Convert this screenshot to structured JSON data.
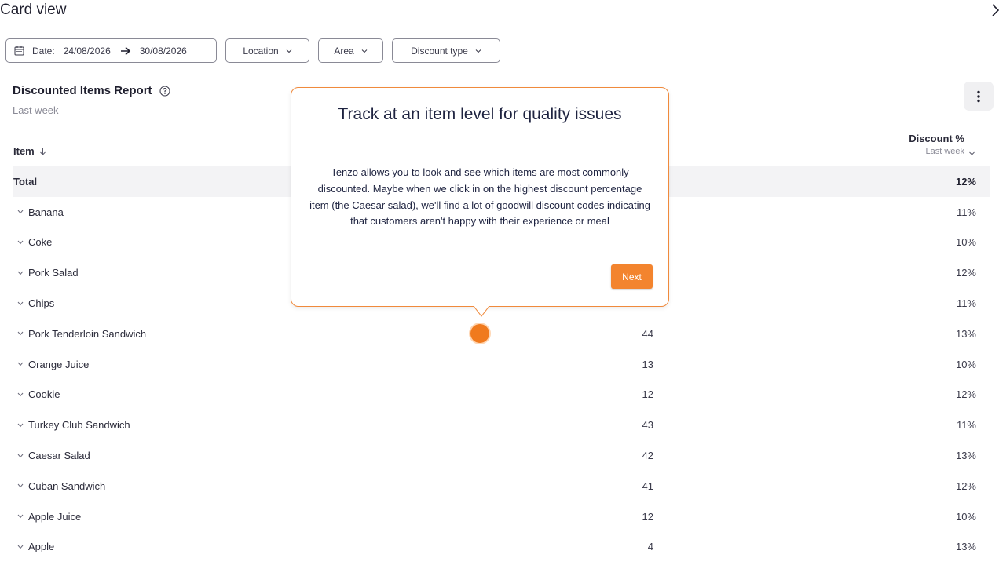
{
  "page": {
    "title": "Card view"
  },
  "filters": {
    "date_label": "Date:",
    "date_from": "24/08/2026",
    "date_to": "30/08/2026",
    "location": "Location",
    "area": "Area",
    "discount_type": "Discount type"
  },
  "report": {
    "title": "Discounted Items Report",
    "subtitle": "Last week"
  },
  "table": {
    "col_item": "Item",
    "col_discount": "Discount %",
    "col_discount_sub": "Last week",
    "total": {
      "name": "Total",
      "pct": "12%"
    },
    "rows": [
      {
        "name": "Banana",
        "count": "",
        "pct": "11%"
      },
      {
        "name": "Coke",
        "count": "",
        "pct": "10%"
      },
      {
        "name": "Pork Salad",
        "count": "",
        "pct": "12%"
      },
      {
        "name": "Chips",
        "count": "",
        "pct": "11%"
      },
      {
        "name": "Pork Tenderloin Sandwich",
        "count": "44",
        "pct": "13%"
      },
      {
        "name": "Orange Juice",
        "count": "13",
        "pct": "10%"
      },
      {
        "name": "Cookie",
        "count": "12",
        "pct": "12%"
      },
      {
        "name": "Turkey Club Sandwich",
        "count": "43",
        "pct": "11%"
      },
      {
        "name": "Caesar Salad",
        "count": "42",
        "pct": "13%"
      },
      {
        "name": "Cuban Sandwich",
        "count": "41",
        "pct": "12%"
      },
      {
        "name": "Apple Juice",
        "count": "12",
        "pct": "10%"
      },
      {
        "name": "Apple",
        "count": "4",
        "pct": "13%"
      }
    ]
  },
  "tooltip": {
    "title": "Track at an item level for quality issues",
    "body": "Tenzo allows you to look and see which items are most commonly discounted. Maybe when we click in on the highest discount percentage item (the Caesar salad), we'll find a lot of goodwill discount codes indicating that customers aren't happy with their experience or meal",
    "next_label": "Next"
  },
  "colors": {
    "accent": "#f3842e",
    "beacon": "#f07a1e"
  }
}
